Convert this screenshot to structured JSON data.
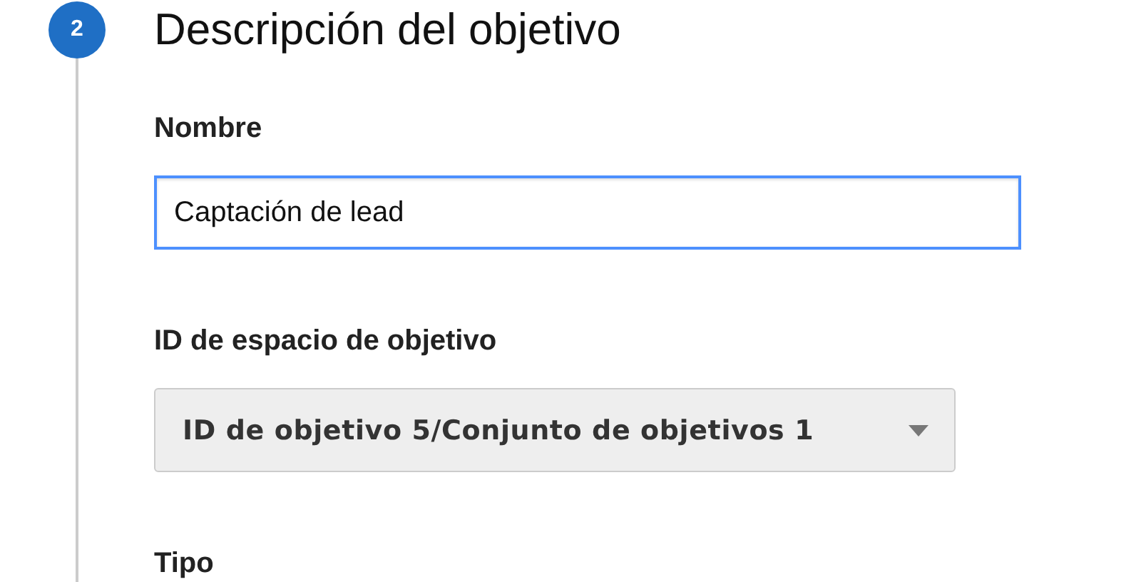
{
  "step": {
    "number": "2",
    "title": "Descripción del objetivo"
  },
  "fields": [
    {
      "kind": "text",
      "label": "Nombre",
      "value": "Captación de lead",
      "focused": true
    },
    {
      "kind": "select",
      "label": "ID de espacio de objetivo",
      "value": "ID de objetivo 5/Conjunto de objetivos 1"
    },
    {
      "kind": "label",
      "label": "Tipo"
    }
  ]
}
